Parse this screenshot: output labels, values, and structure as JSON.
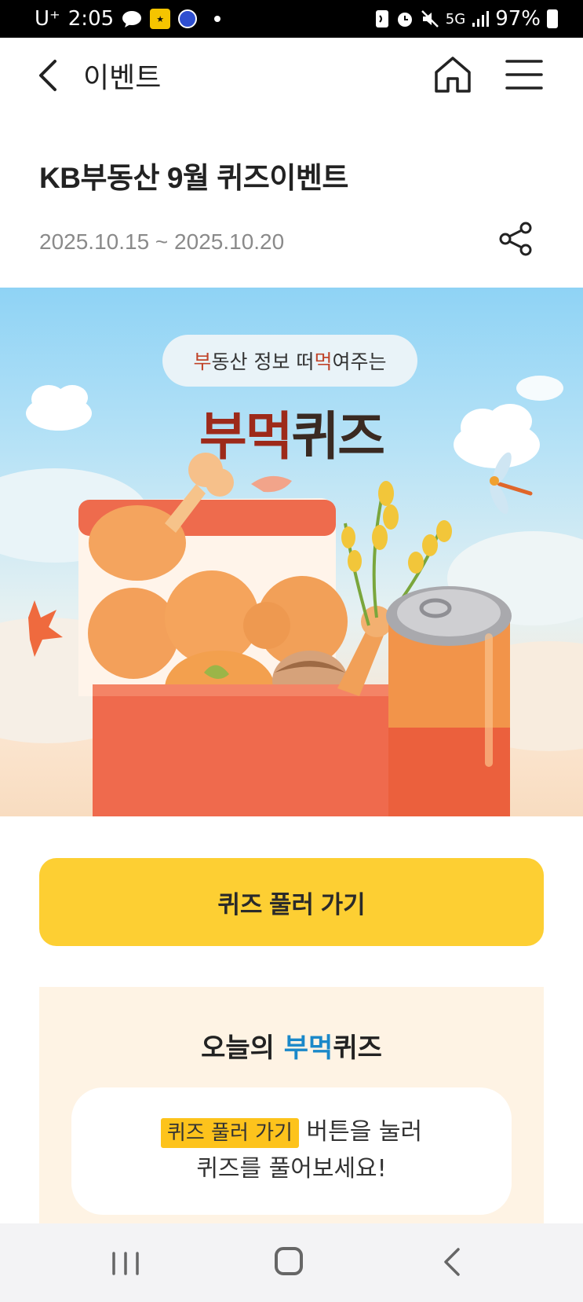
{
  "status_bar": {
    "carrier": "U⁺",
    "time": "2:05",
    "network": "5G",
    "battery": "97%"
  },
  "header": {
    "title": "이벤트"
  },
  "event": {
    "title": "KB부동산 9월 퀴즈이벤트",
    "date_range": "2025.10.15 ~ 2025.10.20"
  },
  "banner": {
    "pill_part1": "부",
    "pill_part2": "동산 정보 떠",
    "pill_part3": "먹",
    "pill_part4": "여주는",
    "headline_red": "부먹",
    "headline_dark": "퀴즈"
  },
  "cta": {
    "label": "퀴즈 풀러 가기"
  },
  "quiz": {
    "heading_prefix": "오늘의 ",
    "heading_blue": "부먹",
    "heading_suffix": "퀴즈",
    "tag": "퀴즈 풀러 가기",
    "line1_rest": " 버튼을 눌러",
    "line2": "퀴즈를 풀어보세요!"
  },
  "colors": {
    "accent_yellow": "#fdcf33",
    "quiz_bg": "#fef3e4",
    "blue": "#1a88c9",
    "banner_red": "#9d2a1a"
  },
  "icons": [
    "back-icon",
    "home-icon",
    "menu-icon",
    "share-icon",
    "recent-apps-icon",
    "nav-home-icon",
    "nav-back-icon"
  ]
}
